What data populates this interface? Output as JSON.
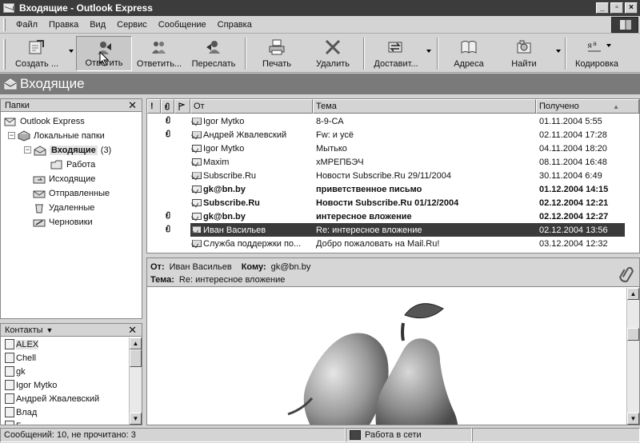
{
  "window": {
    "title": "Входящие - Outlook Express"
  },
  "menu": [
    "Файл",
    "Правка",
    "Вид",
    "Сервис",
    "Сообщение",
    "Справка"
  ],
  "toolbar": {
    "create": "Создать ...",
    "reply": "Ответить",
    "reply_all": "Ответить...",
    "forward": "Переслать",
    "print": "Печать",
    "delete": "Удалить",
    "send_receive": "Доставит...",
    "addresses": "Адреса",
    "find": "Найти",
    "encoding": "Кодировка"
  },
  "folder_header": {
    "title": "Входящие"
  },
  "folders_pane": {
    "title": "Папки",
    "root": "Outlook Express",
    "local": "Локальные папки",
    "inbox": "Входящие",
    "inbox_count": "(3)",
    "work": "Работа",
    "outbox": "Исходящие",
    "sent": "Отправленные",
    "deleted": "Удаленные",
    "drafts": "Черновики"
  },
  "contacts_pane": {
    "title": "Контакты",
    "items": [
      "ALEX",
      "Chell",
      "gk",
      "Igor Mytko",
      "Андрей Жвалевский",
      "Влад",
      "Г"
    ]
  },
  "message_list": {
    "columns": {
      "priority": "!",
      "attachment": "0",
      "flag": "",
      "from": "От",
      "subject": "Тема",
      "received": "Получено"
    },
    "rows": [
      {
        "from": "Igor Mytko",
        "subject": "8-9-СА",
        "received": "01.11.2004 5:55",
        "attachment": true,
        "unread": false,
        "selected": false,
        "icon": "envelope-open"
      },
      {
        "from": "Андрей Жвалевский",
        "subject": "Fw: и усё",
        "received": "02.11.2004 17:28",
        "attachment": true,
        "unread": false,
        "selected": false,
        "icon": "envelope-open"
      },
      {
        "from": "Igor Mytko",
        "subject": "Мытько",
        "received": "04.11.2004 18:20",
        "attachment": false,
        "unread": false,
        "selected": false,
        "icon": "envelope-replied"
      },
      {
        "from": "Maxim",
        "subject": "хМРЕПБЭЧ",
        "received": "08.11.2004 16:48",
        "attachment": false,
        "unread": false,
        "selected": false,
        "icon": "envelope-replied"
      },
      {
        "from": "Subscribe.Ru",
        "subject": "Новости Subscribe.Ru 29/11/2004",
        "received": "30.11.2004 6:49",
        "attachment": false,
        "unread": false,
        "selected": false,
        "icon": "envelope-open"
      },
      {
        "from": "gk@bn.by",
        "subject": "приветственное письмо",
        "received": "01.12.2004 14:15",
        "attachment": false,
        "unread": true,
        "selected": false,
        "icon": "envelope-closed"
      },
      {
        "from": "Subscribe.Ru",
        "subject": "Новости Subscribe.Ru 01/12/2004",
        "received": "02.12.2004 12:21",
        "attachment": false,
        "unread": true,
        "selected": false,
        "icon": "envelope-closed"
      },
      {
        "from": "gk@bn.by",
        "subject": "интересное вложение",
        "received": "02.12.2004 12:27",
        "attachment": true,
        "unread": true,
        "selected": false,
        "icon": "envelope-closed"
      },
      {
        "from": "Иван Васильев",
        "subject": "Re: интересное вложение",
        "received": "02.12.2004 13:56",
        "attachment": true,
        "unread": false,
        "selected": true,
        "icon": "envelope-open"
      },
      {
        "from": "Служба поддержки по...",
        "subject": "Добро пожаловать на Mail.Ru!",
        "received": "03.12.2004 12:32",
        "attachment": false,
        "unread": false,
        "selected": false,
        "icon": "envelope-open"
      }
    ]
  },
  "preview": {
    "from_label": "От:",
    "from": "Иван Васильев",
    "to_label": "Кому:",
    "to": "gk@bn.by",
    "subject_label": "Тема:",
    "subject": "Re: интересное вложение"
  },
  "status": {
    "messages": "Сообщений: 10, не прочитано: 3",
    "connection": "Работа в сети"
  }
}
